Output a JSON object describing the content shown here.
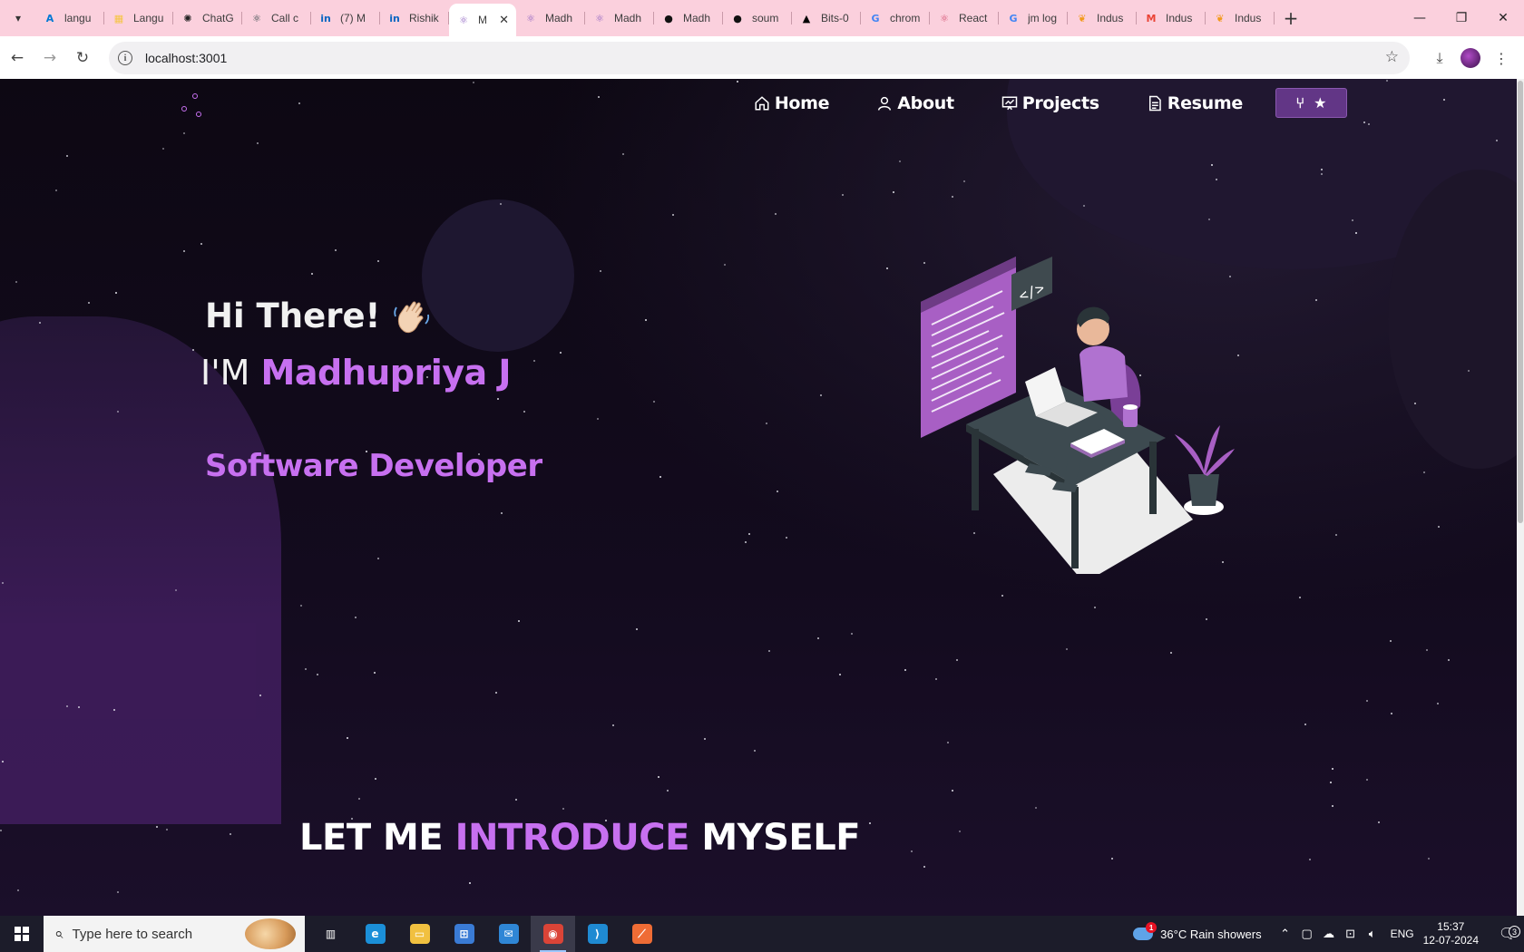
{
  "browser": {
    "tabs": [
      {
        "title": "langu",
        "icon": "azure-icon",
        "color": "#0078d4"
      },
      {
        "title": "Langu",
        "icon": "image-icon",
        "color": "#f5c542"
      },
      {
        "title": "ChatG",
        "icon": "openai-icon",
        "color": "#222222"
      },
      {
        "title": "Call c",
        "icon": "react-icon",
        "color": "#1e3a3a"
      },
      {
        "title": "(7) M",
        "icon": "linkedin-icon",
        "color": "#0a66c2"
      },
      {
        "title": "Rishik",
        "icon": "linkedin-icon",
        "color": "#0a66c2"
      },
      {
        "title": "M",
        "icon": "react-icon",
        "color": "#8c5fc0",
        "active": true
      },
      {
        "title": "Madh",
        "icon": "react-icon",
        "color": "#8c5fc0"
      },
      {
        "title": "Madh",
        "icon": "react-icon",
        "color": "#8c5fc0"
      },
      {
        "title": "Madh",
        "icon": "github-icon",
        "color": "#111111"
      },
      {
        "title": "soum",
        "icon": "github-icon",
        "color": "#111111"
      },
      {
        "title": "Bits-0",
        "icon": "vercel-icon",
        "color": "#000000"
      },
      {
        "title": "chrom",
        "icon": "google-icon",
        "color": "#4285f4"
      },
      {
        "title": "React",
        "icon": "react-icon",
        "color": "#d24a6b"
      },
      {
        "title": "jm log",
        "icon": "google-icon",
        "color": "#4285f4"
      },
      {
        "title": "Indus",
        "icon": "indus-icon",
        "color": "#f29a1b"
      },
      {
        "title": "Indus",
        "icon": "gmail-icon",
        "color": "#ea4335"
      },
      {
        "title": "Indus",
        "icon": "indus-icon",
        "color": "#f29a1b"
      }
    ],
    "url": "localhost:3001"
  },
  "site": {
    "nav": [
      {
        "label": "Home",
        "icon": "home-icon"
      },
      {
        "label": "About",
        "icon": "user-icon"
      },
      {
        "label": "Projects",
        "icon": "projects-icon"
      },
      {
        "label": "Resume",
        "icon": "document-icon"
      }
    ],
    "github_button": {
      "fork": "⑂",
      "star": "★"
    },
    "hero": {
      "greeting": "Hi There!",
      "name_prefix": "I'M",
      "name": "Madhupriya J",
      "role": "Software Developer"
    },
    "intro": {
      "part1": "LET ME",
      "part2": "INTRODUCE",
      "part3": "MYSELF"
    },
    "accent_color": "#c770f0"
  },
  "taskbar": {
    "search_placeholder": "Type here to search",
    "weather": {
      "temp": "36°C",
      "condition": "Rain showers",
      "badge": "1"
    },
    "language": "ENG",
    "time": "15:37",
    "date": "12-07-2024",
    "notifications": "3",
    "apps": [
      {
        "name": "task-view-icon",
        "active": false
      },
      {
        "name": "edge-icon",
        "active": false
      },
      {
        "name": "file-explorer-icon",
        "active": false
      },
      {
        "name": "store-icon",
        "active": false
      },
      {
        "name": "mail-icon",
        "active": false
      },
      {
        "name": "chrome-icon",
        "active": true
      },
      {
        "name": "vscode-icon",
        "active": false
      },
      {
        "name": "postman-icon",
        "active": false
      }
    ]
  }
}
